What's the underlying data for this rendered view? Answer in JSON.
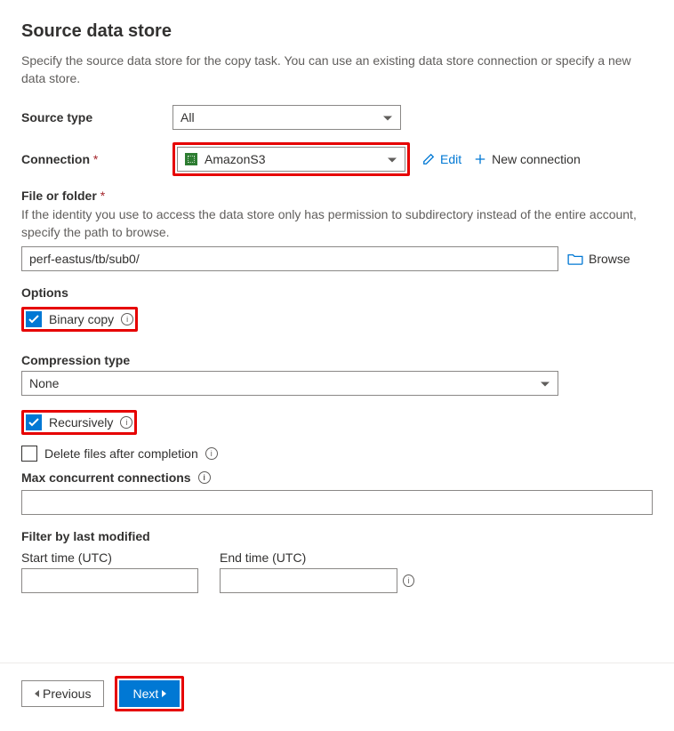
{
  "header": {
    "title": "Source data store",
    "subtitle": "Specify the source data store for the copy task. You can use an existing data store connection or specify a new data store."
  },
  "sourceType": {
    "label": "Source type",
    "value": "All"
  },
  "connection": {
    "label": "Connection",
    "value": "AmazonS3",
    "edit": "Edit",
    "newConnection": "New connection"
  },
  "fileFolder": {
    "label": "File or folder",
    "help": "If the identity you use to access the data store only has permission to subdirectory instead of the entire account, specify the path to browse.",
    "value": "perf-eastus/tb/sub0/",
    "browse": "Browse"
  },
  "options": {
    "label": "Options",
    "binaryCopy": "Binary copy",
    "recursively": "Recursively",
    "deleteAfter": "Delete files after completion"
  },
  "compression": {
    "label": "Compression type",
    "value": "None"
  },
  "maxConn": {
    "label": "Max concurrent connections",
    "value": ""
  },
  "filter": {
    "label": "Filter by last modified",
    "start": "Start time (UTC)",
    "end": "End time (UTC)"
  },
  "footer": {
    "previous": "Previous",
    "next": "Next"
  }
}
